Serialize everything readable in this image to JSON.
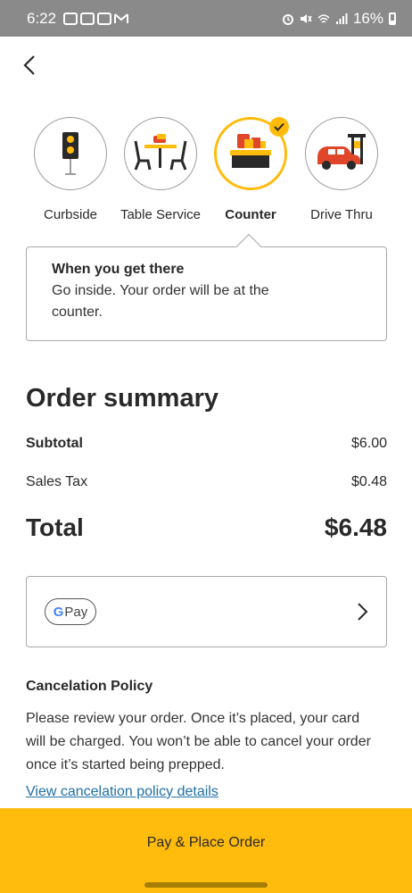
{
  "status_bar": {
    "time": "6:22",
    "battery": "16%",
    "notification_icons": [
      "twitch-icon",
      "twitch-icon",
      "twitch-icon",
      "gmail-icon"
    ],
    "system_icons": [
      "alarm-icon",
      "mute-icon",
      "wifi-icon",
      "signal-icon",
      "battery-icon"
    ]
  },
  "header": {
    "back_icon": "chevron-left-icon"
  },
  "pickup_options": [
    {
      "label": "Curbside",
      "icon": "curbside-icon",
      "selected": false
    },
    {
      "label": "Table Service",
      "icon": "table-service-icon",
      "selected": false
    },
    {
      "label": "Counter",
      "icon": "counter-icon",
      "selected": true
    },
    {
      "label": "Drive Thru",
      "icon": "drive-thru-icon",
      "selected": false
    }
  ],
  "info": {
    "title": "When you get there",
    "body": "Go inside. Your order will be at the counter."
  },
  "summary": {
    "title": "Order summary",
    "subtotal_label": "Subtotal",
    "subtotal_value": "$6.00",
    "tax_label": "Sales Tax",
    "tax_value": "$0.48",
    "total_label": "Total",
    "total_value": "$6.48"
  },
  "payment": {
    "method_g": "G",
    "method_label": "Pay",
    "chevron_icon": "chevron-right-icon"
  },
  "cancellation": {
    "title": "Cancelation Policy",
    "body": "Please review your order. Once it’s placed, your card will be charged. You won’t be able to cancel your order once it’s started being prepped.",
    "link": "View cancelation policy details"
  },
  "cta": {
    "label": "Pay & Place Order"
  },
  "colors": {
    "accent": "#ffbc0d",
    "link": "#1f6fa8",
    "status_bar": "#8a8a8a"
  }
}
